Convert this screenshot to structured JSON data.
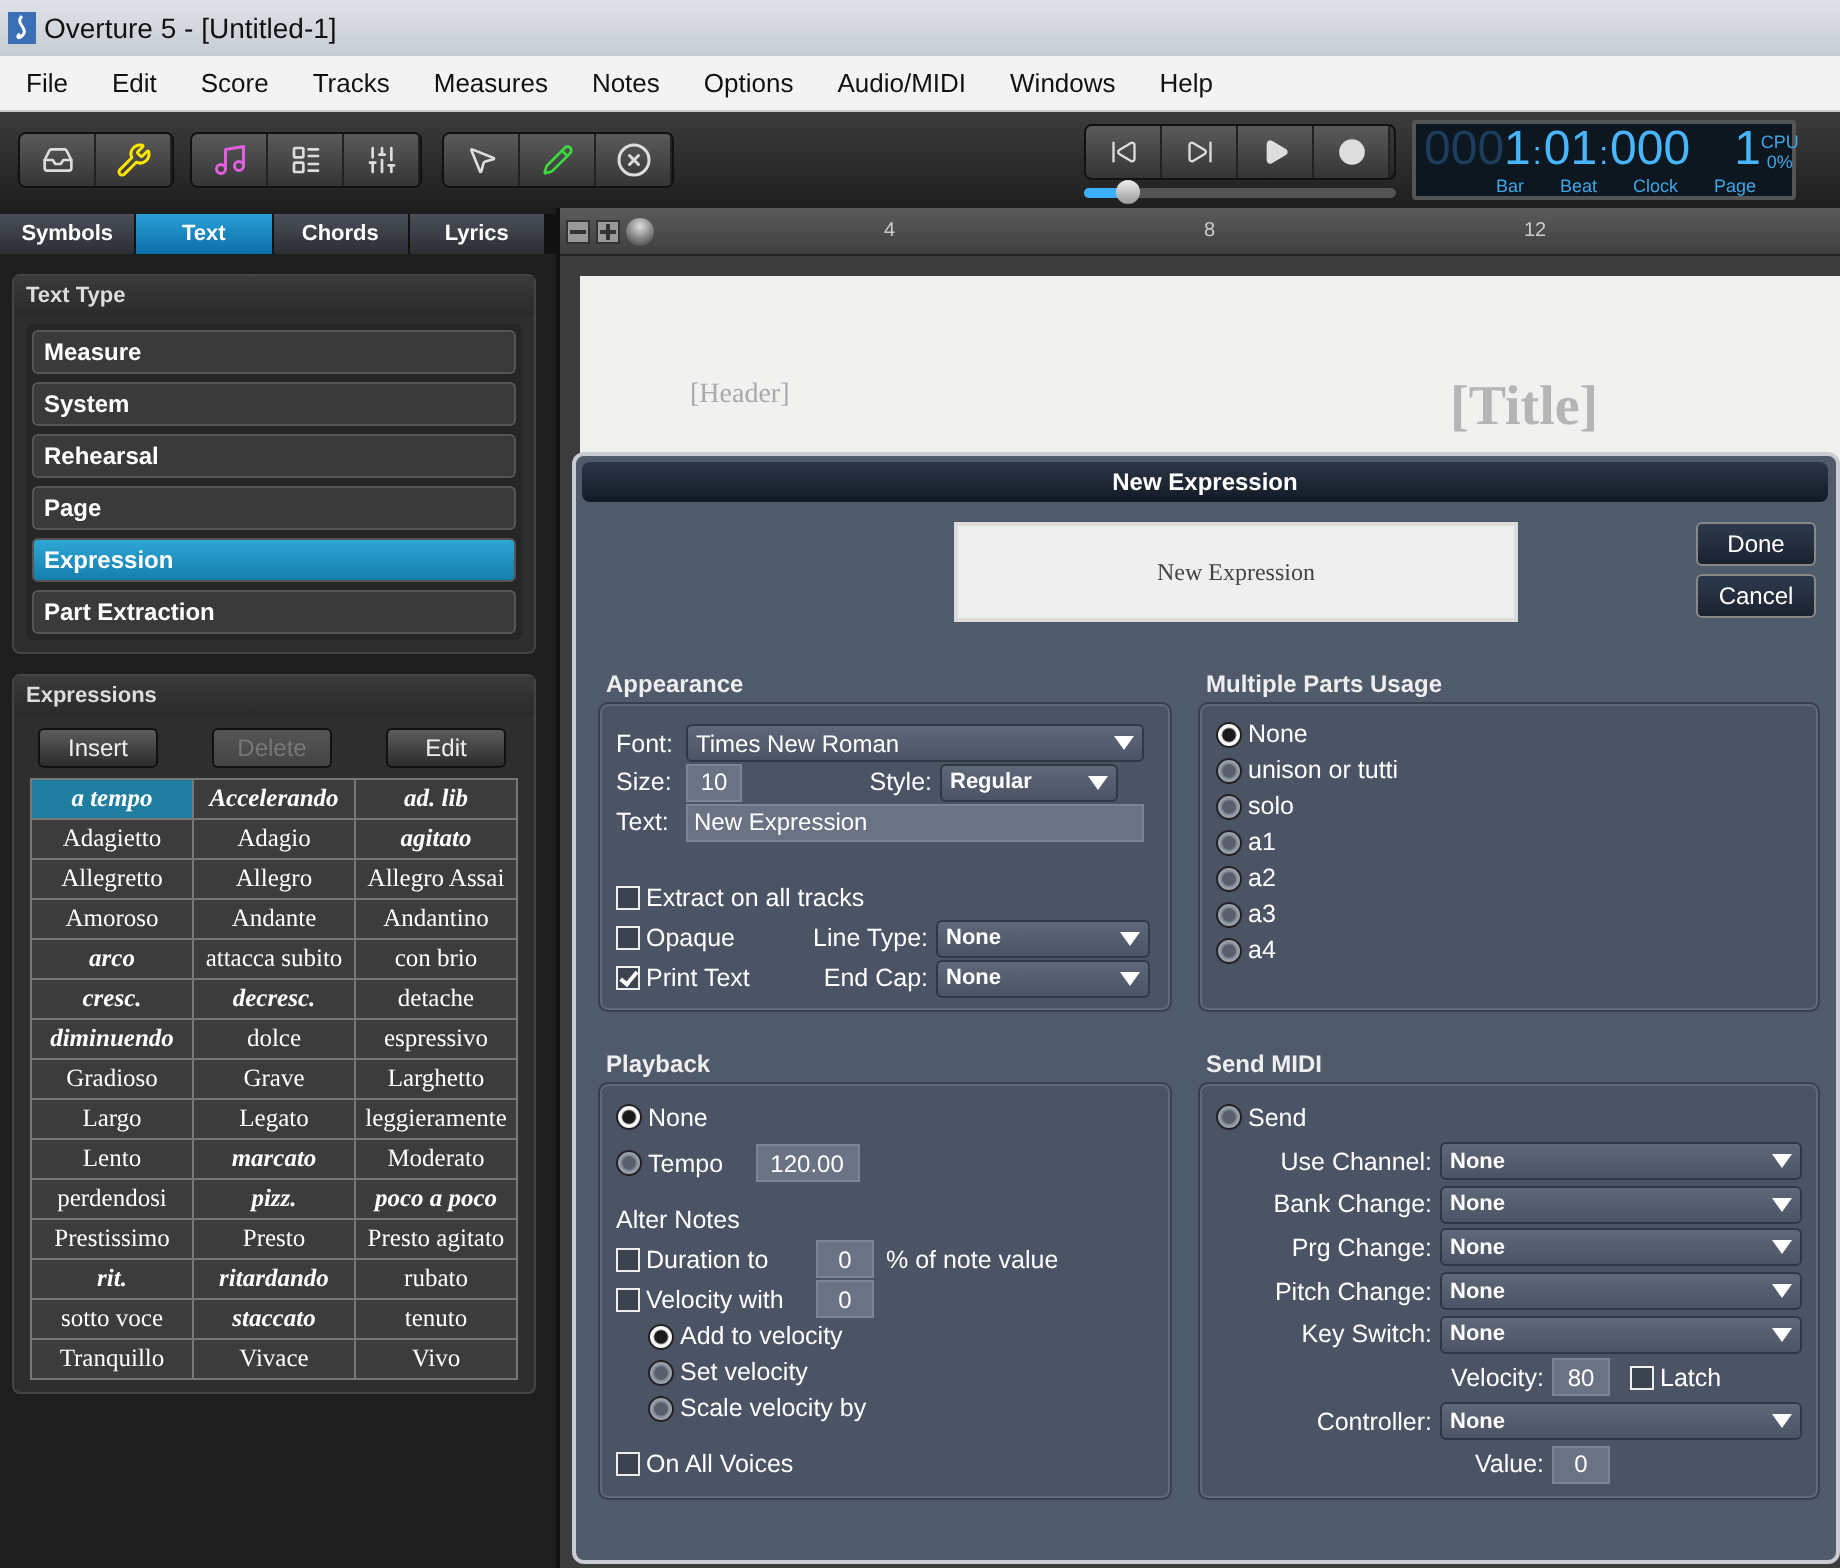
{
  "window": {
    "title": "Overture 5 - [Untitled-1]"
  },
  "menu": [
    "File",
    "Edit",
    "Score",
    "Tracks",
    "Measures",
    "Notes",
    "Options",
    "Audio/MIDI",
    "Windows",
    "Help"
  ],
  "transport": {
    "scrub": {
      "level": 0.14
    }
  },
  "counter": {
    "bar_pad": "000",
    "bar": "1",
    "sep1": ":",
    "beat": "01",
    "sep2": ":",
    "clock": "000",
    "page": "1",
    "cpu_label": "CPU",
    "cpu_value": "0%",
    "labels": [
      "Bar",
      "Beat",
      "Clock",
      "Page"
    ]
  },
  "palette_tabs": [
    {
      "label": "Symbols",
      "selected": false
    },
    {
      "label": "Text",
      "selected": true
    },
    {
      "label": "Chords",
      "selected": false
    },
    {
      "label": "Lyrics",
      "selected": false
    }
  ],
  "text_type": {
    "title": "Text Type",
    "items": [
      {
        "label": "Measure",
        "selected": false
      },
      {
        "label": "System",
        "selected": false
      },
      {
        "label": "Rehearsal",
        "selected": false
      },
      {
        "label": "Page",
        "selected": false
      },
      {
        "label": "Expression",
        "selected": true
      },
      {
        "label": "Part Extraction",
        "selected": false
      }
    ]
  },
  "expressions": {
    "title": "Expressions",
    "buttons": [
      {
        "label": "Insert",
        "disabled": false
      },
      {
        "label": "Delete",
        "disabled": true
      },
      {
        "label": "Edit",
        "disabled": false
      }
    ],
    "cells": [
      {
        "text": "a tempo",
        "bold_italic": true,
        "selected": true
      },
      {
        "text": "Accelerando",
        "bold_italic": true,
        "selected": false
      },
      {
        "text": "ad. lib",
        "bold_italic": true,
        "selected": false
      },
      {
        "text": "Adagietto",
        "bold_italic": false,
        "selected": false
      },
      {
        "text": "Adagio",
        "bold_italic": false,
        "selected": false
      },
      {
        "text": "agitato",
        "bold_italic": true,
        "selected": false
      },
      {
        "text": "Allegretto",
        "bold_italic": false,
        "selected": false
      },
      {
        "text": "Allegro",
        "bold_italic": false,
        "selected": false
      },
      {
        "text": "Allegro Assai",
        "bold_italic": false,
        "selected": false
      },
      {
        "text": "Amoroso",
        "bold_italic": false,
        "selected": false
      },
      {
        "text": "Andante",
        "bold_italic": false,
        "selected": false
      },
      {
        "text": "Andantino",
        "bold_italic": false,
        "selected": false
      },
      {
        "text": "arco",
        "bold_italic": true,
        "selected": false
      },
      {
        "text": "attacca subito",
        "bold_italic": false,
        "selected": false
      },
      {
        "text": "con brio",
        "bold_italic": false,
        "selected": false
      },
      {
        "text": "cresc.",
        "bold_italic": true,
        "selected": false
      },
      {
        "text": "decresc.",
        "bold_italic": true,
        "selected": false
      },
      {
        "text": "detache",
        "bold_italic": false,
        "selected": false
      },
      {
        "text": "diminuendo",
        "bold_italic": true,
        "selected": false
      },
      {
        "text": "dolce",
        "bold_italic": false,
        "selected": false
      },
      {
        "text": "espressivo",
        "bold_italic": false,
        "selected": false
      },
      {
        "text": "Gradioso",
        "bold_italic": false,
        "selected": false
      },
      {
        "text": "Grave",
        "bold_italic": false,
        "selected": false
      },
      {
        "text": "Larghetto",
        "bold_italic": false,
        "selected": false
      },
      {
        "text": "Largo",
        "bold_italic": false,
        "selected": false
      },
      {
        "text": "Legato",
        "bold_italic": false,
        "selected": false
      },
      {
        "text": "leggieramente",
        "bold_italic": false,
        "selected": false
      },
      {
        "text": "Lento",
        "bold_italic": false,
        "selected": false
      },
      {
        "text": "marcato",
        "bold_italic": true,
        "selected": false
      },
      {
        "text": "Moderato",
        "bold_italic": false,
        "selected": false
      },
      {
        "text": "perdendosi",
        "bold_italic": false,
        "selected": false
      },
      {
        "text": "pizz.",
        "bold_italic": true,
        "selected": false
      },
      {
        "text": "poco a poco",
        "bold_italic": true,
        "selected": false
      },
      {
        "text": "Prestissimo",
        "bold_italic": false,
        "selected": false
      },
      {
        "text": "Presto",
        "bold_italic": false,
        "selected": false
      },
      {
        "text": "Presto agitato",
        "bold_italic": false,
        "selected": false
      },
      {
        "text": "rit.",
        "bold_italic": true,
        "selected": false
      },
      {
        "text": "ritardando",
        "bold_italic": true,
        "selected": false
      },
      {
        "text": "rubato",
        "bold_italic": false,
        "selected": false
      },
      {
        "text": "sotto voce",
        "bold_italic": false,
        "selected": false
      },
      {
        "text": "staccato",
        "bold_italic": true,
        "selected": false
      },
      {
        "text": "tenuto",
        "bold_italic": false,
        "selected": false
      },
      {
        "text": "Tranquillo",
        "bold_italic": false,
        "selected": false
      },
      {
        "text": "Vivace",
        "bold_italic": false,
        "selected": false
      },
      {
        "text": "Vivo",
        "bold_italic": false,
        "selected": false
      }
    ]
  },
  "ruler": {
    "ticks": [
      "4",
      "8",
      "12"
    ]
  },
  "score": {
    "header": "[Header]",
    "title": "[Title]"
  },
  "dialog": {
    "title": "New Expression",
    "preview": "New Expression",
    "buttons": [
      "Done",
      "Cancel"
    ],
    "appearance": {
      "heading": "Appearance",
      "font": {
        "label": "Font:",
        "value": "Times New Roman"
      },
      "size": {
        "label": "Size:",
        "value": "10"
      },
      "style": {
        "label": "Style:",
        "value": "Regular"
      },
      "text": {
        "label": "Text:",
        "value": "New Expression"
      },
      "checks": [
        {
          "label": "Extract on all tracks",
          "checked": false
        },
        {
          "label": "Opaque",
          "checked": false
        },
        {
          "label": "Print Text",
          "checked": true
        }
      ],
      "line_type": {
        "label": "Line Type:",
        "value": "None"
      },
      "end_cap": {
        "label": "End Cap:",
        "value": "None"
      }
    },
    "parts_usage": {
      "heading": "Multiple Parts Usage",
      "options": [
        {
          "label": "None",
          "selected": true
        },
        {
          "label": "unison or tutti",
          "selected": false
        },
        {
          "label": "solo",
          "selected": false
        },
        {
          "label": "a1",
          "selected": false
        },
        {
          "label": "a2",
          "selected": false
        },
        {
          "label": "a3",
          "selected": false
        },
        {
          "label": "a4",
          "selected": false
        }
      ]
    },
    "playback": {
      "heading": "Playback",
      "options": [
        {
          "label": "None",
          "selected": true
        },
        {
          "label": "Tempo",
          "selected": false
        }
      ],
      "tempo_value": "120.00",
      "alter_heading": "Alter Notes",
      "duration": {
        "label": "Duration to",
        "checked": false,
        "value": "0",
        "suffix": "% of note value"
      },
      "velocity": {
        "label": "Velocity with",
        "checked": false,
        "value": "0"
      },
      "velocity_modes": [
        {
          "label": "Add to velocity",
          "selected": true
        },
        {
          "label": "Set velocity",
          "selected": false
        },
        {
          "label": "Scale velocity by",
          "selected": false
        }
      ],
      "voices": {
        "label": "On All Voices",
        "checked": false
      }
    },
    "send_midi": {
      "heading": "Send MIDI",
      "send": {
        "label": "Send",
        "selected": false
      },
      "rows": [
        {
          "kind": "select",
          "label": "Use Channel:",
          "value": "None"
        },
        {
          "kind": "select",
          "label": "Bank Change:",
          "value": "None"
        },
        {
          "kind": "select",
          "label": "Prg Change:",
          "value": "None"
        },
        {
          "kind": "select",
          "label": "Pitch Change:",
          "value": "None"
        },
        {
          "kind": "select",
          "label": "Key Switch:",
          "value": "None"
        },
        {
          "kind": "number",
          "label": "Velocity:",
          "value": "80",
          "latch": {
            "label": "Latch",
            "checked": false
          }
        },
        {
          "kind": "select",
          "label": "Controller:",
          "value": "None"
        },
        {
          "kind": "number",
          "label": "Value:",
          "value": "0"
        }
      ]
    }
  }
}
